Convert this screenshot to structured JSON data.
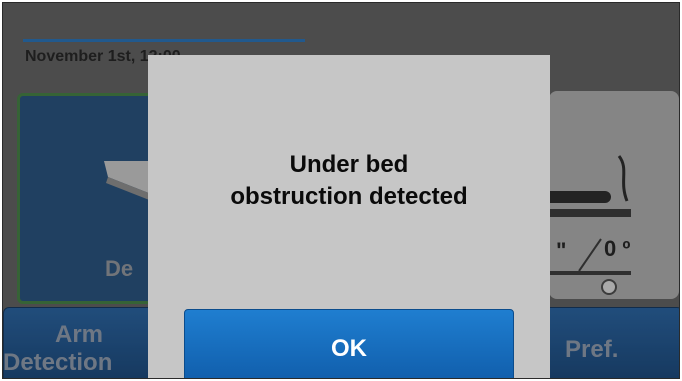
{
  "status": {
    "date_visible": "November 1st, 12:00"
  },
  "left_panel": {
    "label_fragment": "De"
  },
  "right_panel": {
    "angle": "0 º",
    "quote_mark": "\""
  },
  "bottom_buttons": {
    "arm_line1": "Arm",
    "arm_line2": "Detection",
    "pref": "Pref."
  },
  "dialog": {
    "message_line1": "Under bed",
    "message_line2": "obstruction detected",
    "ok_label": "OK"
  },
  "colors": {
    "accent": "#1f6db5",
    "dialog_bg": "#c6c6c6",
    "ok_button": "#1f7ed0"
  },
  "icons": {
    "left": "bed-tilt-icon",
    "right": "bed-side-icon"
  }
}
